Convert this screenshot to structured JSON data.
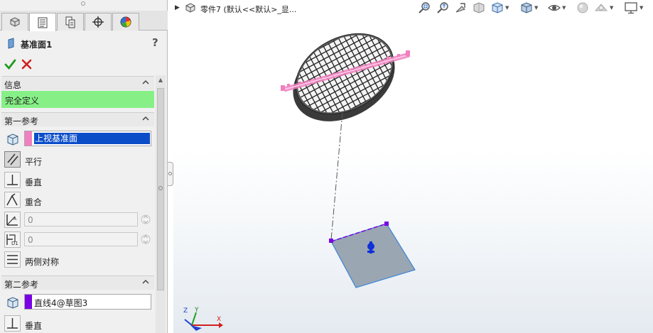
{
  "property_manager": {
    "tabs": [
      {
        "icon": "feature-manager-icon"
      },
      {
        "icon": "property-manager-icon",
        "active": true
      },
      {
        "icon": "configuration-manager-icon"
      },
      {
        "icon": "dimxpert-icon"
      },
      {
        "icon": "display-manager-icon"
      }
    ],
    "feature_title": "基准面1",
    "help": "?",
    "info": {
      "header": "信息",
      "status": "完全定义",
      "status_color": "#86f086"
    },
    "first_reference": {
      "header": "第一参考",
      "selection": "上视基准面",
      "swatch_color": "#f080c0",
      "options": {
        "parallel": "平行",
        "perpendicular": "垂直",
        "coincident": "重合"
      },
      "angle_value": "0",
      "distance_value": "0",
      "mid_plane": "两侧对称"
    },
    "second_reference": {
      "header": "第二参考",
      "selection": "直线4@草图3",
      "swatch_color": "#7a00e6",
      "perpendicular": "垂直"
    }
  },
  "viewport": {
    "part_name": "零件7 (默认<<默认>_显...",
    "hud_icons": [
      "zoom-to-fit-icon",
      "zoom-to-area-icon",
      "previous-view-icon",
      "section-view-icon",
      "view-orientation-icon",
      "display-style-icon",
      "hide-show-items-icon",
      "edit-appearance-icon",
      "apply-scene-icon",
      "view-settings-icon"
    ],
    "triad": {
      "x": "X",
      "y": "Y",
      "z": "Z"
    },
    "selection_color": "#f080c0",
    "plane_color": "#9aa6b2"
  }
}
